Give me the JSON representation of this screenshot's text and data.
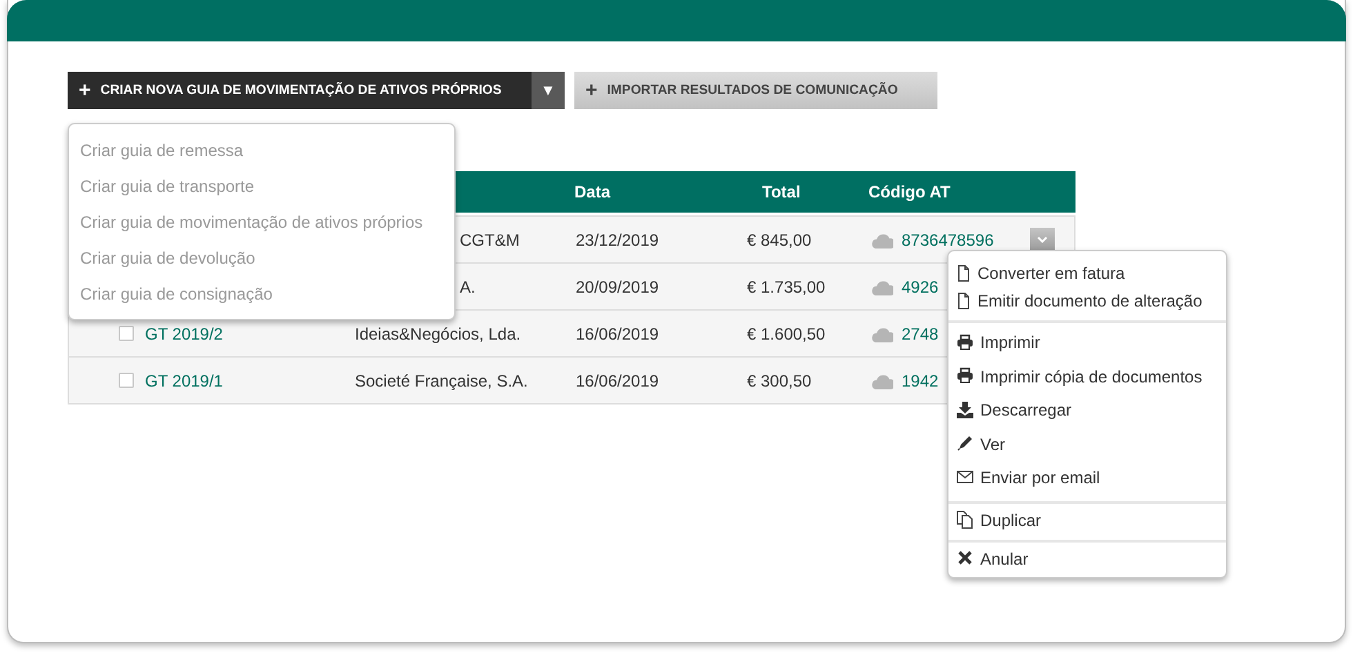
{
  "toolbar": {
    "create_button": {
      "label": "CRIAR NOVA GUIA DE MOVIMENTAÇÃO DE ATIVOS PRÓPRIOS",
      "icon": "+",
      "caret": "▼"
    },
    "import_button": {
      "label": "IMPORTAR RESULTADOS DE COMUNICAÇÃO",
      "icon": "+"
    }
  },
  "create_menu": {
    "items": [
      {
        "label": "Criar guia de remessa"
      },
      {
        "label": "Criar guia de transporte"
      },
      {
        "label": "Criar guia de movimentação de ativos próprios"
      },
      {
        "label": "Criar guia de devolução"
      },
      {
        "label": "Criar guia de consignação"
      }
    ]
  },
  "table": {
    "columns": [
      "Data",
      "Total",
      "Código AT"
    ],
    "rows": [
      {
        "client": "CGT&M",
        "date": "23/12/2019",
        "total": "€ 845,00",
        "code": "8736478596",
        "actions_button": true
      },
      {
        "client": "A.",
        "date": "20/09/2019",
        "total": "€ 1.735,00",
        "code": "4926",
        "actions_button": false
      },
      {
        "document": "GT 2019/2",
        "checked": false,
        "client": "Ideias&Negócios, Lda.",
        "date": "16/06/2019",
        "total": "€ 1.600,50",
        "code": "2748",
        "actions_button": false
      },
      {
        "document": "GT 2019/1",
        "checked": false,
        "client": "Societé Française, S.A.",
        "date": "16/06/2019",
        "total": "€ 300,50",
        "code": "1942",
        "actions_button": false
      }
    ]
  },
  "actions_menu": {
    "groups": [
      [
        {
          "kind": "document",
          "label": "Converter em fatura"
        },
        {
          "kind": "document",
          "label": "Emitir documento de alteração"
        }
      ],
      [
        {
          "kind": "printer",
          "label": "Imprimir"
        },
        {
          "kind": "printer",
          "label": "Imprimir cópia de documentos"
        },
        {
          "kind": "download",
          "label": "Descarregar"
        },
        {
          "kind": "pencil",
          "label": "Ver"
        },
        {
          "kind": "envelope",
          "label": "Enviar por email"
        }
      ],
      [
        {
          "kind": "copy",
          "label": "Duplicar"
        }
      ],
      [
        {
          "kind": "cross",
          "label": "Anular"
        }
      ]
    ]
  }
}
